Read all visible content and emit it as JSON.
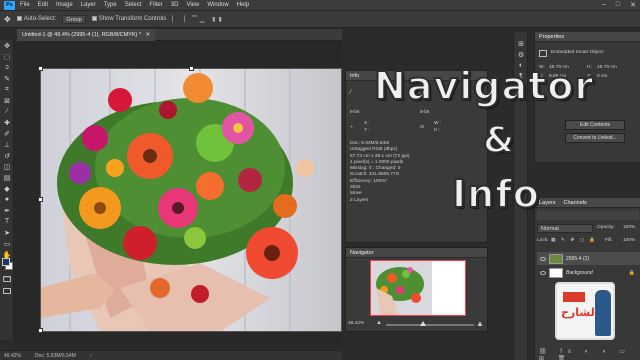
{
  "menubar": {
    "logo": "Ps",
    "items": [
      "File",
      "Edit",
      "Image",
      "Layer",
      "Type",
      "Select",
      "Filter",
      "3D",
      "View",
      "Window",
      "Help"
    ]
  },
  "options": {
    "auto_select": "Auto-Select:",
    "group": "Group",
    "show_transform": "Show Transform Controls"
  },
  "document": {
    "tab": "Untitled-1 @ 49.4% (2995-4 (1), RGB/8/CMYK) *"
  },
  "status": {
    "zoom": "49.42%",
    "doc": "Doc: 5.93M/6.54M"
  },
  "info_panel": {
    "title": "Info",
    "bits_left": "8-bit",
    "bits_right": "8-bit",
    "x_label": "X :",
    "y_label": "Y :",
    "w_label": "W :",
    "h_label": "H :",
    "details": [
      "Doc: 5.93M/6.54M",
      "Untagged RGB (8bpc)",
      "67.73 cm x 38.1 cm (72 ppi)",
      "1 pixel(s) = 1.0000 pixels",
      "Missing: 0 ; Changed: 0",
      "Scratch: 341.8M/5.77G",
      "Efficiency: 100%*",
      "352s",
      "Move",
      "2 Layers"
    ]
  },
  "navigator_panel": {
    "title": "Navigator",
    "zoom": "49.42%"
  },
  "properties_panel": {
    "title": "Properties",
    "subtitle": "Embedded Smart Object",
    "w_label": "W:",
    "w_value": "48.79 cm",
    "h_label": "H:",
    "h_value": "48.79 cm",
    "x_label": "X:",
    "x_value": "9.88 cm",
    "y_label": "Y:",
    "y_value": "0 cm",
    "edit_contents": "Edit Contents",
    "convert_linked": "Convert to Linked..."
  },
  "layers_panel": {
    "tabs": [
      "Layers",
      "Channels"
    ],
    "blend_mode": "Normal",
    "opacity_label": "Opacity:",
    "opacity": "100%",
    "lock_label": "Lock:",
    "fill_label": "Fill:",
    "fill": "100%",
    "layers": [
      "2995-4 (1)",
      "Background"
    ]
  },
  "overlay": {
    "line1": "Navigator",
    "line2": "&",
    "line3": "Info",
    "logo_text": "الشارح"
  },
  "colors": {
    "accent": "#31a8ff",
    "panel": "#3a3a3a",
    "bg": "#282828"
  }
}
